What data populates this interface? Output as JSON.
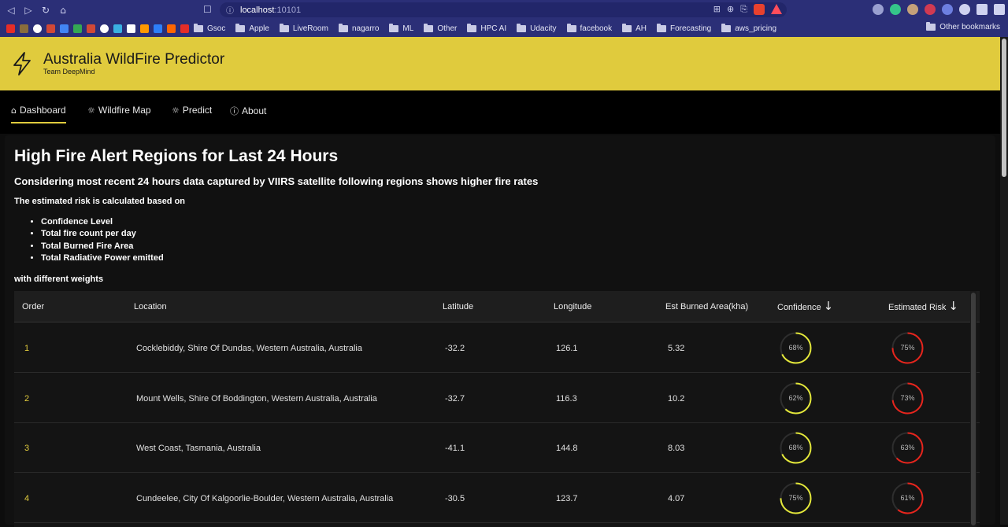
{
  "browser": {
    "url_host": "localhost",
    "url_port": ":10101",
    "bookmarks": [
      "Gsoc",
      "Apple",
      "LiveRoom",
      "nagarro",
      "ML",
      "Other",
      "HPC AI",
      "Udacity",
      "facebook",
      "AH",
      "Forecasting",
      "aws_pricing"
    ],
    "other_bookmarks": "Other bookmarks"
  },
  "app": {
    "title": "Australia WildFire Predictor",
    "subtitle": "Team DeepMind"
  },
  "nav": {
    "tabs": [
      {
        "label": "Dashboard",
        "icon": "home-icon",
        "active": true
      },
      {
        "label": "Wildfire Map",
        "icon": "bulb-icon",
        "active": false
      },
      {
        "label": "Predict",
        "icon": "bulb-icon",
        "active": false
      },
      {
        "label": "About",
        "icon": "info-icon",
        "active": false
      }
    ]
  },
  "page": {
    "heading": "High Fire Alert Regions for Last 24 Hours",
    "subheading": "Considering most recent 24 hours data captured by VIIRS satellite following regions shows higher fire rates",
    "intro": "The estimated risk is calculated based on",
    "factors": [
      "Confidence Level",
      "Total fire count per day",
      "Total Burned Fire Area",
      "Total Radiative Power emitted"
    ],
    "outro": "with different weights"
  },
  "table": {
    "columns": [
      "Order",
      "Location",
      "Latitude",
      "Longitude",
      "Est Burned Area(kha)",
      "Confidence",
      "Estimated Risk"
    ],
    "rows": [
      {
        "order": "1",
        "location": "Cocklebiddy, Shire Of Dundas, Western Australia, Australia",
        "lat": "-32.2",
        "lon": "126.1",
        "area": "5.32",
        "confidence": 68,
        "confidence_label": "68%",
        "risk": 75,
        "risk_label": "75%"
      },
      {
        "order": "2",
        "location": "Mount Wells, Shire Of Boddington, Western Australia, Australia",
        "lat": "-32.7",
        "lon": "116.3",
        "area": "10.2",
        "confidence": 62,
        "confidence_label": "62%",
        "risk": 73,
        "risk_label": "73%"
      },
      {
        "order": "3",
        "location": "West Coast, Tasmania, Australia",
        "lat": "-41.1",
        "lon": "144.8",
        "area": "8.03",
        "confidence": 68,
        "confidence_label": "68%",
        "risk": 63,
        "risk_label": "63%"
      },
      {
        "order": "4",
        "location": "Cundeelee, City Of Kalgoorlie-Boulder, Western Australia, Australia",
        "lat": "-30.5",
        "lon": "123.7",
        "area": "4.07",
        "confidence": 75,
        "confidence_label": "75%",
        "risk": 61,
        "risk_label": "61%"
      }
    ]
  },
  "colors": {
    "accent": "#e0cb3d",
    "confidence_ring": "#e4e83a",
    "risk_ring": "#e8241c",
    "ring_track": "#2e2e2e"
  }
}
